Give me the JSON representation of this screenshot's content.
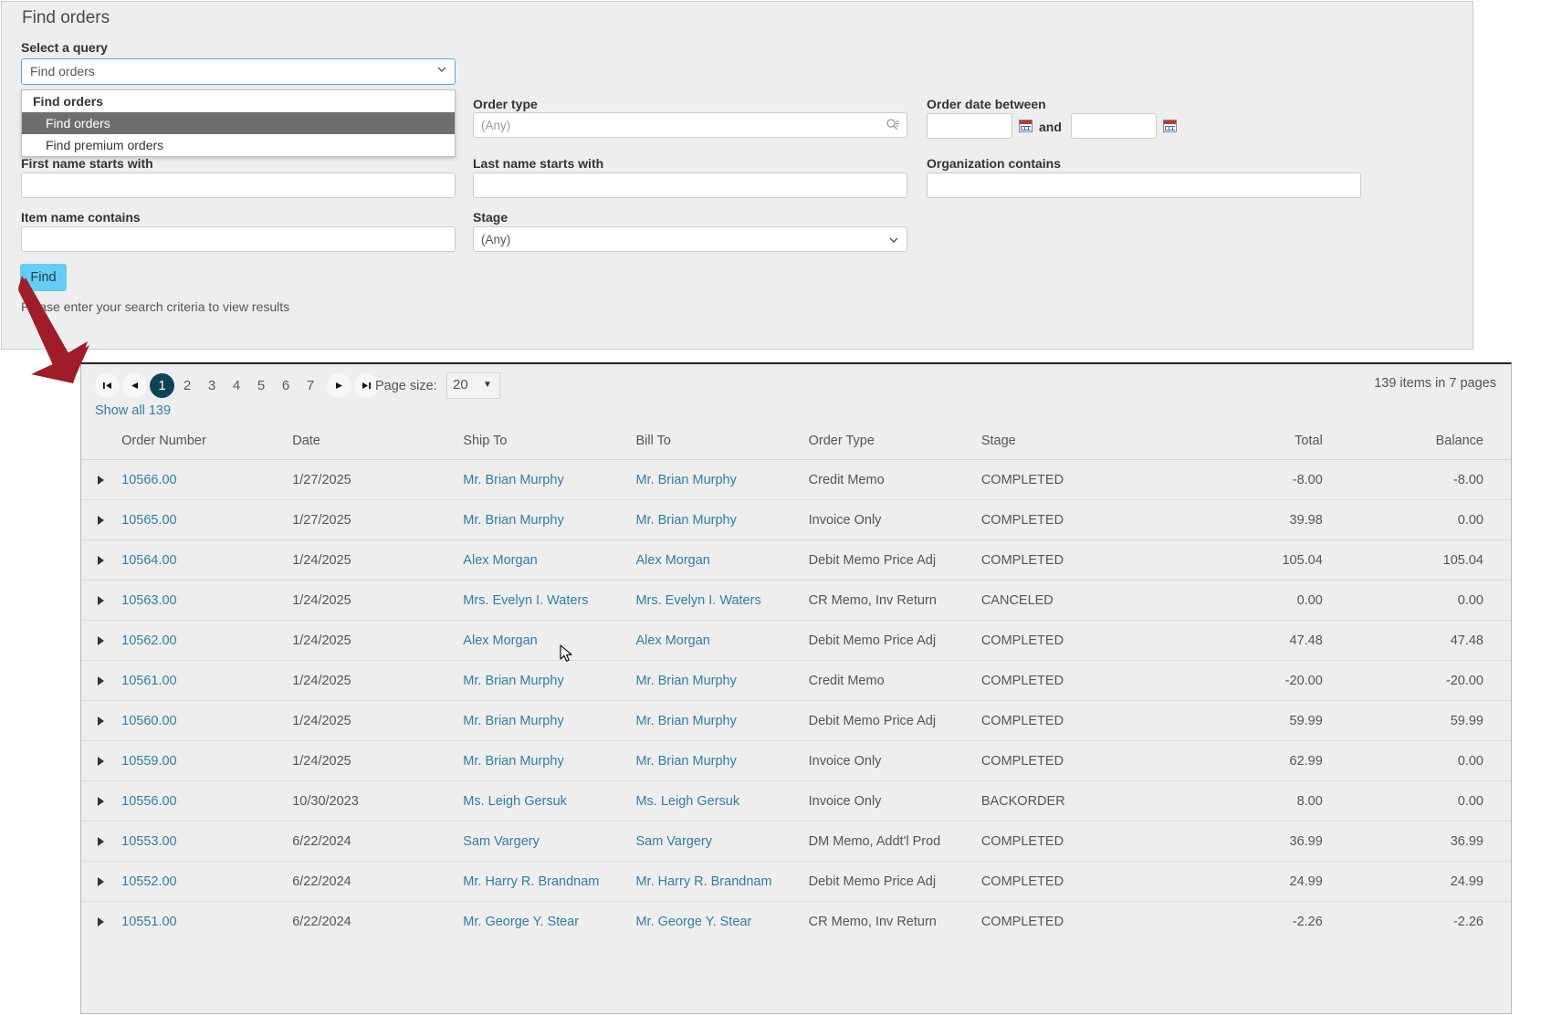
{
  "find_panel": {
    "title": "Find orders",
    "query_label": "Select a query",
    "query_value": "Find orders",
    "dropdown": {
      "group_label": "Find orders",
      "items": [
        {
          "label": "Find orders",
          "selected": true
        },
        {
          "label": "Find premium orders",
          "selected": false
        }
      ]
    },
    "fields": {
      "first_name_label": "First name starts with",
      "first_name_value": "",
      "order_type_label": "Order type",
      "order_type_placeholder": "(Any)",
      "order_type_value": "",
      "order_date_label": "Order date between",
      "order_date_from": "",
      "order_date_to": "",
      "and_label": "and",
      "last_name_label": "Last name starts with",
      "last_name_value": "",
      "organization_label": "Organization contains",
      "organization_value": "",
      "item_name_label": "Item name contains",
      "item_name_value": "",
      "stage_label": "Stage",
      "stage_value": "(Any)"
    },
    "find_button": "Find",
    "hint": "Please enter your search criteria to view results"
  },
  "results": {
    "pager": {
      "first_glyph": "⏮",
      "prev_glyph": "◀",
      "next_glyph": "▶",
      "last_glyph": "⏭",
      "pages": [
        "1",
        "2",
        "3",
        "4",
        "5",
        "6",
        "7"
      ],
      "current_page": "1",
      "page_size_label": "Page size:",
      "page_size_value": "20",
      "page_size_arrow": "▼"
    },
    "show_all": "Show all 139",
    "item_count": "139 items in 7 pages",
    "columns": [
      "Order Number",
      "Date",
      "Ship To",
      "Bill To",
      "Order Type",
      "Stage",
      "Total",
      "Balance"
    ],
    "rows": [
      {
        "order": "10566.00",
        "date": "1/27/2025",
        "ship": "Mr. Brian Murphy",
        "bill": "Mr. Brian Murphy",
        "type": "Credit Memo",
        "stage": "COMPLETED",
        "total": "-8.00",
        "balance": "-8.00"
      },
      {
        "order": "10565.00",
        "date": "1/27/2025",
        "ship": "Mr. Brian Murphy",
        "bill": "Mr. Brian Murphy",
        "type": "Invoice Only",
        "stage": "COMPLETED",
        "total": "39.98",
        "balance": "0.00"
      },
      {
        "order": "10564.00",
        "date": "1/24/2025",
        "ship": "Alex Morgan",
        "bill": "Alex Morgan",
        "type": "Debit Memo Price Adj",
        "stage": "COMPLETED",
        "total": "105.04",
        "balance": "105.04"
      },
      {
        "order": "10563.00",
        "date": "1/24/2025",
        "ship": "Mrs. Evelyn I. Waters",
        "bill": "Mrs. Evelyn I. Waters",
        "type": "CR Memo, Inv Return",
        "stage": "CANCELED",
        "total": "0.00",
        "balance": "0.00"
      },
      {
        "order": "10562.00",
        "date": "1/24/2025",
        "ship": "Alex Morgan",
        "bill": "Alex Morgan",
        "type": "Debit Memo Price Adj",
        "stage": "COMPLETED",
        "total": "47.48",
        "balance": "47.48"
      },
      {
        "order": "10561.00",
        "date": "1/24/2025",
        "ship": "Mr. Brian Murphy",
        "bill": "Mr. Brian Murphy",
        "type": "Credit Memo",
        "stage": "COMPLETED",
        "total": "-20.00",
        "balance": "-20.00"
      },
      {
        "order": "10560.00",
        "date": "1/24/2025",
        "ship": "Mr. Brian Murphy",
        "bill": "Mr. Brian Murphy",
        "type": "Debit Memo Price Adj",
        "stage": "COMPLETED",
        "total": "59.99",
        "balance": "59.99"
      },
      {
        "order": "10559.00",
        "date": "1/24/2025",
        "ship": "Mr. Brian Murphy",
        "bill": "Mr. Brian Murphy",
        "type": "Invoice Only",
        "stage": "COMPLETED",
        "total": "62.99",
        "balance": "0.00"
      },
      {
        "order": "10556.00",
        "date": "10/30/2023",
        "ship": "Ms. Leigh Gersuk",
        "bill": "Ms. Leigh Gersuk",
        "type": "Invoice Only",
        "stage": "BACKORDER",
        "total": "8.00",
        "balance": "0.00"
      },
      {
        "order": "10553.00",
        "date": "6/22/2024",
        "ship": "Sam Vargery",
        "bill": "Sam Vargery",
        "type": "DM Memo, Addt'l Prod",
        "stage": "COMPLETED",
        "total": "36.99",
        "balance": "36.99"
      },
      {
        "order": "10552.00",
        "date": "6/22/2024",
        "ship": "Mr. Harry R. Brandnam",
        "bill": "Mr. Harry R. Brandnam",
        "type": "Debit Memo Price Adj",
        "stage": "COMPLETED",
        "total": "24.99",
        "balance": "24.99"
      },
      {
        "order": "10551.00",
        "date": "6/22/2024",
        "ship": "Mr. George Y. Stear",
        "bill": "Mr. George Y. Stear",
        "type": "CR Memo, Inv Return",
        "stage": "COMPLETED",
        "total": "-2.26",
        "balance": "-2.26"
      }
    ]
  },
  "colors": {
    "panel_bg": "#eeeeee",
    "link": "#2f7ea8",
    "accent_button": "#63cdf6",
    "active_page": "#0d4257",
    "arrow": "#a01c28"
  }
}
